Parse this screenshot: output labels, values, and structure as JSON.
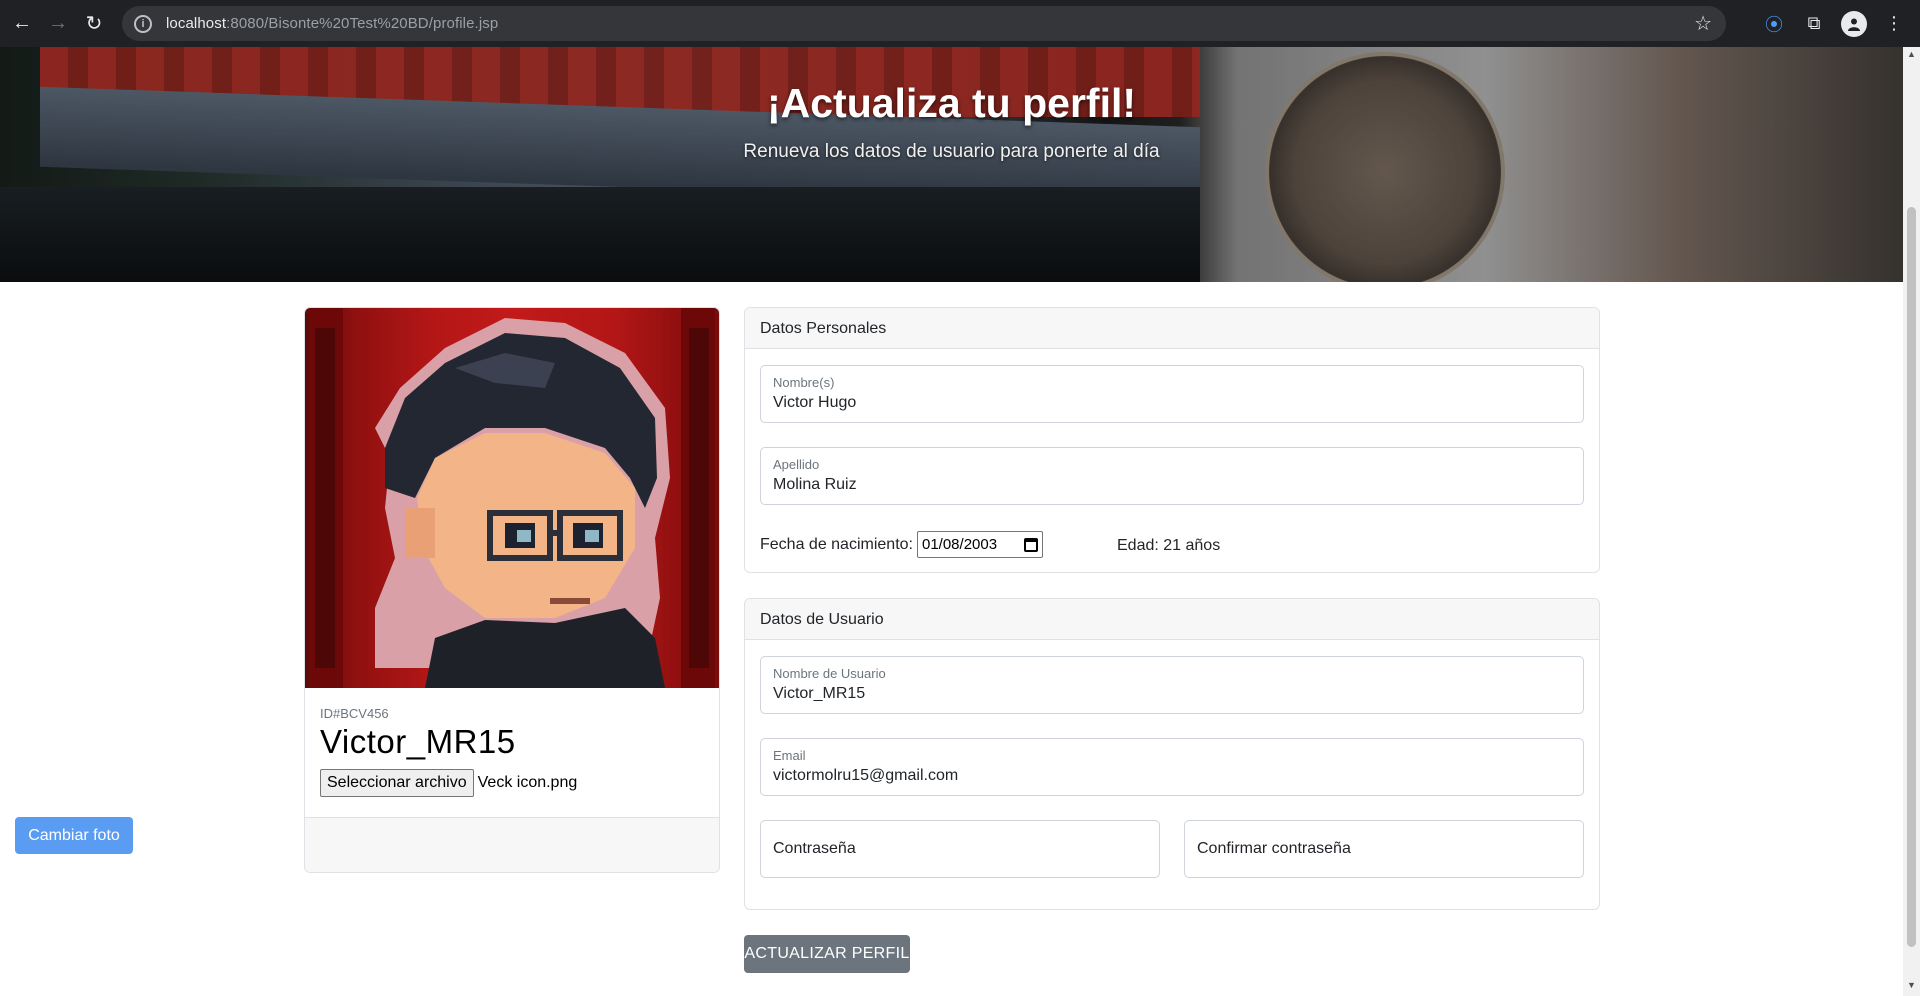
{
  "browser": {
    "url_host": "localhost",
    "url_path": ":8080/Bisonte%20Test%20BD/profile.jsp"
  },
  "hero": {
    "title": "¡Actualiza tu perfil!",
    "subtitle": "Renueva los datos de usuario para ponerte al día"
  },
  "profile": {
    "id": "ID#BCV456",
    "username": "Victor_MR15",
    "file_button": "Seleccionar archivo",
    "file_name": "Veck icon.png",
    "change_photo": "Cambiar foto"
  },
  "personal": {
    "header": "Datos Personales",
    "nombre_label": "Nombre(s)",
    "nombre_value": "Victor Hugo",
    "apellido_label": "Apellido",
    "apellido_value": "Molina Ruiz",
    "dob_label": "Fecha de nacimiento:",
    "dob_value": "01/08/2003",
    "age": "Edad: 21 años"
  },
  "usuario": {
    "header": "Datos de Usuario",
    "username_label": "Nombre de Usuario",
    "username_value": "Victor_MR15",
    "email_label": "Email",
    "email_value": "victormolru15@gmail.com",
    "password_placeholder": "Contraseña",
    "confirm_placeholder": "Confirmar contraseña"
  },
  "actions": {
    "submit": "ACTUALIZAR PERFIL"
  },
  "colors": {
    "primary": "#5b9cf3",
    "secondary": "#6c757d",
    "avatar_bg": "#b31616"
  }
}
